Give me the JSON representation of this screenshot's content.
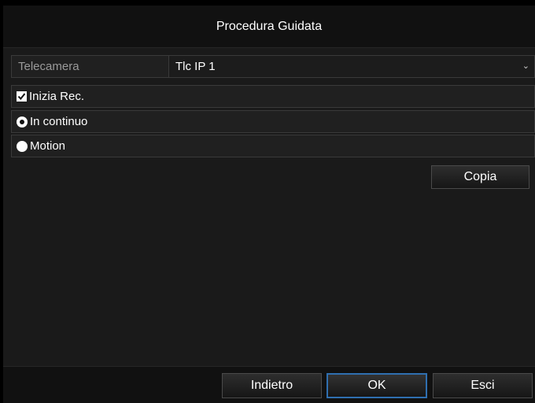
{
  "dialog": {
    "title": "Procedura Guidata"
  },
  "camera": {
    "label": "Telecamera",
    "value": "Tlc IP 1"
  },
  "options": {
    "start_rec": {
      "label": "Inizia Rec.",
      "checked": true
    },
    "continuous": {
      "label": "In continuo",
      "selected": true
    },
    "motion": {
      "label": "Motion",
      "selected": false
    }
  },
  "buttons": {
    "copy": "Copia",
    "back": "Indietro",
    "ok": "OK",
    "exit": "Esci"
  },
  "colors": {
    "ok_focus_border": "#2f6fb0"
  }
}
